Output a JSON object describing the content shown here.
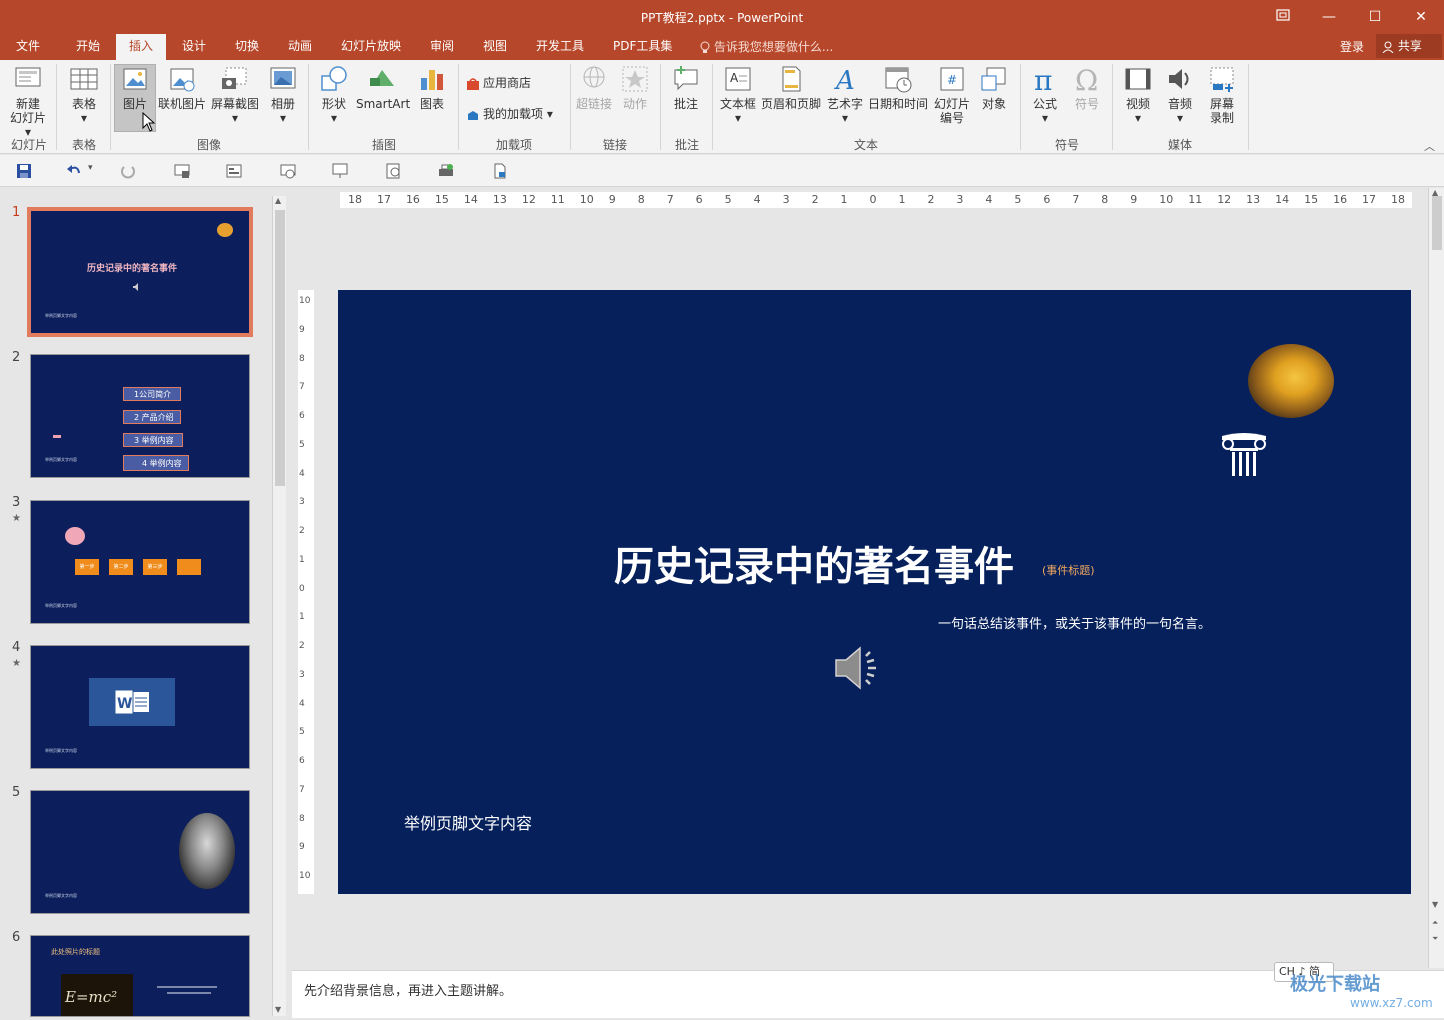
{
  "window": {
    "title": "PPT教程2.pptx - PowerPoint",
    "restore_icon": "restore-icon",
    "minimize_label": "—",
    "maximize_label": "☐",
    "close_label": "✕"
  },
  "tabs": [
    {
      "label": "文件",
      "active": false
    },
    {
      "label": "开始",
      "active": false
    },
    {
      "label": "插入",
      "active": true
    },
    {
      "label": "设计",
      "active": false
    },
    {
      "label": "切换",
      "active": false
    },
    {
      "label": "动画",
      "active": false
    },
    {
      "label": "幻灯片放映",
      "active": false
    },
    {
      "label": "审阅",
      "active": false
    },
    {
      "label": "视图",
      "active": false
    },
    {
      "label": "开发工具",
      "active": false
    },
    {
      "label": "PDF工具集",
      "active": false
    }
  ],
  "tellme": "告诉我您想要做什么...",
  "account": {
    "login": "登录",
    "share": "共享"
  },
  "ribbon": {
    "new_slide": [
      "新建",
      "幻灯片"
    ],
    "table": "表格",
    "picture": "图片",
    "online_picture": "联机图片",
    "screenshot": "屏幕截图",
    "album": "相册",
    "shapes": "形状",
    "smartart": "SmartArt",
    "chart": "图表",
    "store": "应用商店",
    "my_addins": "我的加载项",
    "hyperlink": "超链接",
    "action": "动作",
    "comment": "批注",
    "textbox": "文本框",
    "header_footer": "页眉和页脚",
    "wordart": "艺术字",
    "datetime": "日期和时间",
    "slide_number": [
      "幻灯片",
      "编号"
    ],
    "object": "对象",
    "equation": "公式",
    "symbol": "符号",
    "video": "视频",
    "audio": "音频",
    "screen_record": [
      "屏幕",
      "录制"
    ],
    "groups": {
      "slides": "幻灯片",
      "tables": "表格",
      "images": "图像",
      "illustrations": "插图",
      "addins": "加载项",
      "links": "链接",
      "comments": "批注",
      "text": "文本",
      "symbols": "符号",
      "media": "媒体"
    }
  },
  "thumbnails": {
    "numbers": [
      "1",
      "2",
      "3",
      "4",
      "5",
      "6"
    ],
    "footer_text": "举例页脚文字内容",
    "slide1_title": "历史记录中的著名事件",
    "slide2_items": [
      "1公司简介",
      "2 产品介绍",
      "3 举例内容",
      "4 举例内容"
    ],
    "slide3_items": [
      "第一步",
      "第二步",
      "第三步",
      ""
    ],
    "slide6_title": "此处照片的标题",
    "slide6_formula": "E=mc²"
  },
  "slide": {
    "title": "历史记录中的著名事件",
    "tag": "(事件标题)",
    "subtitle": "一句话总结该事件，或关于该事件的一句名言。",
    "footer": "举例页脚文字内容"
  },
  "ruler": {
    "h": [
      "18",
      "17",
      "16",
      "15",
      "14",
      "13",
      "12",
      "11",
      "10",
      "9",
      "8",
      "7",
      "6",
      "5",
      "4",
      "3",
      "2",
      "1",
      "0",
      "1",
      "2",
      "3",
      "4",
      "5",
      "6",
      "7",
      "8",
      "9",
      "10",
      "11",
      "12",
      "13",
      "14",
      "15",
      "16",
      "17",
      "18"
    ],
    "v": [
      "10",
      "9",
      "8",
      "7",
      "6",
      "5",
      "4",
      "3",
      "2",
      "1",
      "0",
      "1",
      "2",
      "3",
      "4",
      "5",
      "6",
      "7",
      "8",
      "9",
      "10"
    ]
  },
  "notes": "先介绍背景信息，再进入主题讲解。",
  "ime": "CH ♪ 简",
  "watermark": {
    "name": "极光下载站",
    "url": "www.xz7.com"
  },
  "colors": {
    "accent": "#b7472a",
    "slide_bg": "#06205c",
    "selection": "#e07b5e"
  }
}
